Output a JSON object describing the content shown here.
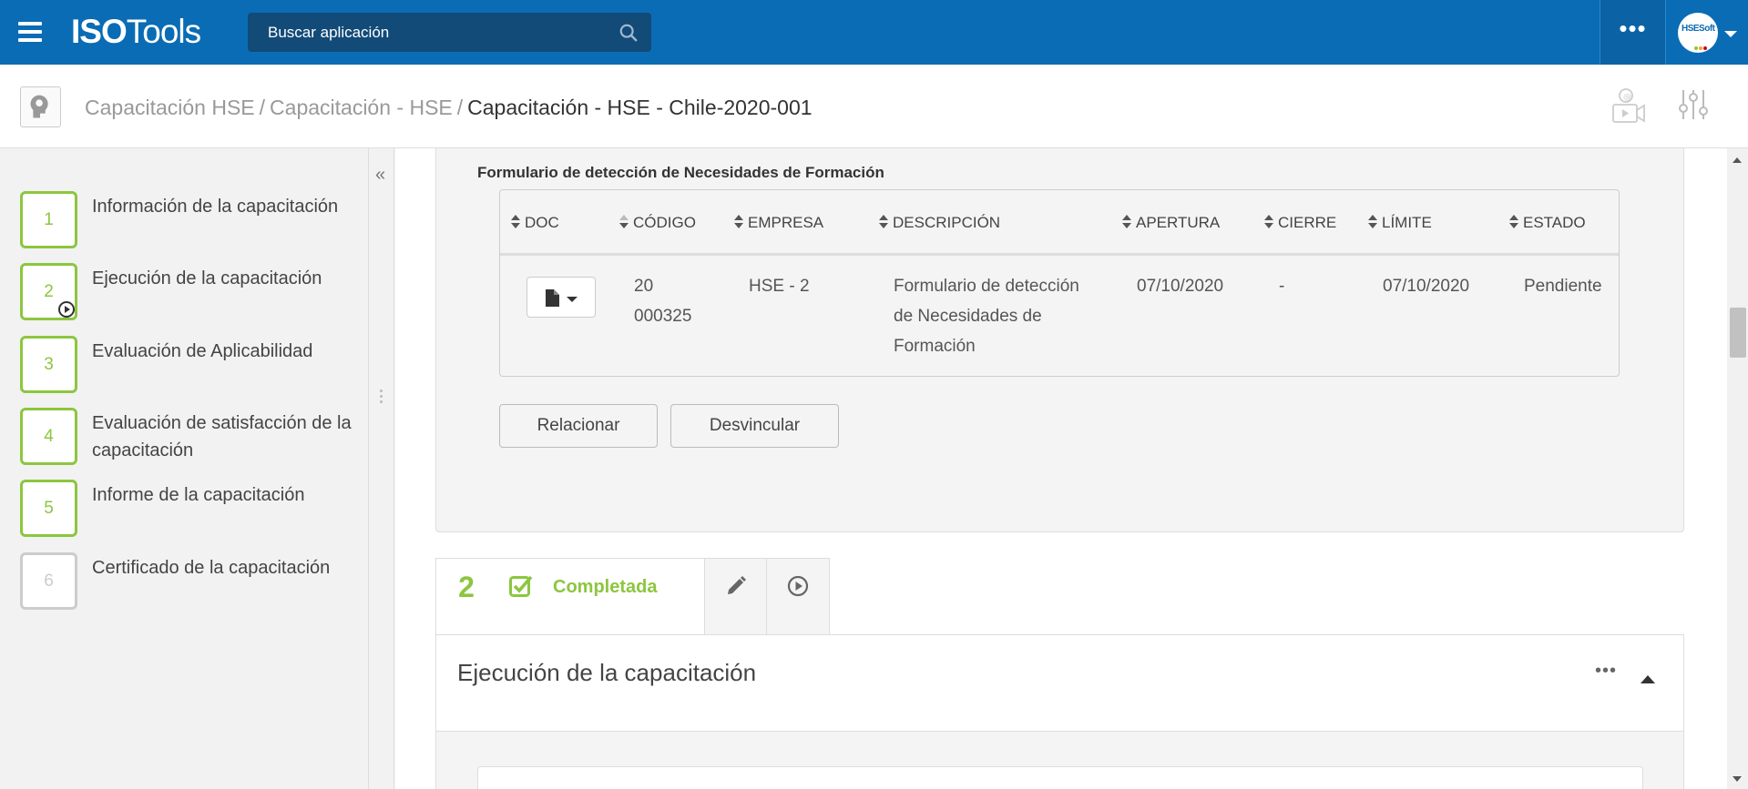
{
  "app": {
    "logo_bold": "ISO",
    "logo_light": "Tools",
    "search_placeholder": "Buscar aplicación",
    "more_label": "•••",
    "avatar_text": "HSESoft",
    "brand_color": "#0a6cb4",
    "accent_color": "#8cc63f"
  },
  "breadcrumb": {
    "items": [
      "Capacitación HSE",
      "Capacitación - HSE"
    ],
    "separator": "/",
    "current": "Capacitación - HSE - Chile-2020-001"
  },
  "sidebar": {
    "collapse_label": "«",
    "steps": [
      {
        "num": "1",
        "label": "Información de la capacitación"
      },
      {
        "num": "2",
        "label": "Ejecución de la capacitación"
      },
      {
        "num": "3",
        "label": "Evaluación de Aplicabilidad"
      },
      {
        "num": "4",
        "label": "Evaluación de satisfacción de la capacitación"
      },
      {
        "num": "5",
        "label": "Informe de la capacitación"
      },
      {
        "num": "6",
        "label": "Certificado de la capacitación"
      }
    ]
  },
  "form": {
    "title": "Formulario de detección de Necesidades de Formación",
    "columns": [
      "DOC",
      "CÓDIGO",
      "EMPRESA",
      "DESCRIPCIÓN",
      "APERTURA",
      "CIERRE",
      "LÍMITE",
      "ESTADO"
    ],
    "row": {
      "codigo_line1": "20",
      "codigo_line2": "000325",
      "empresa": "HSE - 2",
      "descripcion_line1": "Formulario de detección",
      "descripcion_line2": "de Necesidades de",
      "descripcion_line3": "Formación",
      "apertura": "07/10/2020",
      "cierre": "-",
      "limite": "07/10/2020",
      "estado": "Pendiente"
    },
    "relate_label": "Relacionar",
    "unlink_label": "Desvincular"
  },
  "step_tab": {
    "number": "2",
    "status": "Completada"
  },
  "section": {
    "title": "Ejecución de la capacitación",
    "more_label": "•••"
  }
}
